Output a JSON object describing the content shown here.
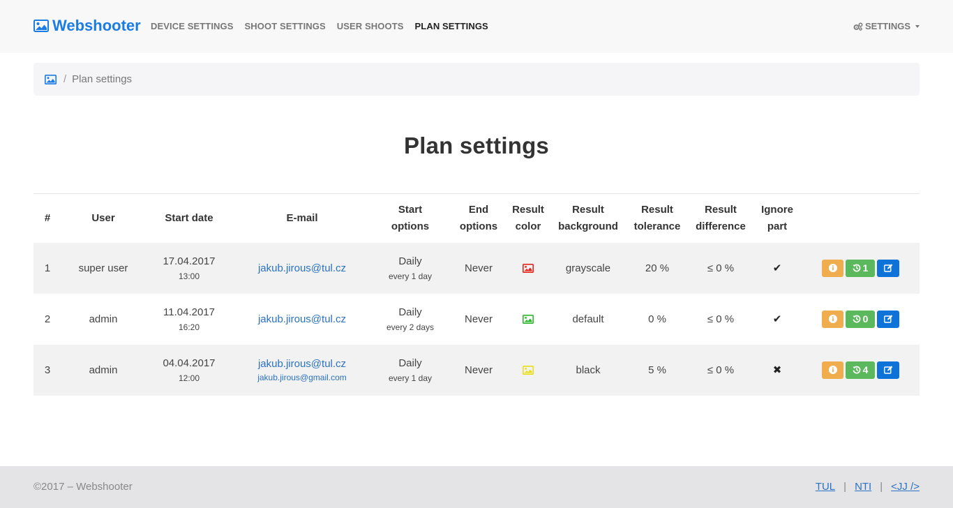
{
  "brand": {
    "name": "Webshooter",
    "icon": "image-icon"
  },
  "nav": {
    "items": [
      {
        "label": "DEVICE SETTINGS",
        "active": false
      },
      {
        "label": "SHOOT SETTINGS",
        "active": false
      },
      {
        "label": "USER SHOOTS",
        "active": false
      },
      {
        "label": "PLAN SETTINGS",
        "active": true
      }
    ],
    "settings_label": "SETTINGS",
    "settings_icon": "gears-icon"
  },
  "breadcrumb": {
    "home_icon": "image-icon",
    "separator": "/",
    "current": "Plan settings"
  },
  "page_title": "Plan settings",
  "table": {
    "headers": [
      "#",
      "User",
      "Start date",
      "E-mail",
      "Start options",
      "End options",
      "Result color",
      "Result background",
      "Result tolerance",
      "Result difference",
      "Ignore part"
    ],
    "rows": [
      {
        "num": "1",
        "user": "super user",
        "date": "17.04.2017",
        "time": "13:00",
        "email": "jakub.jirous@tul.cz",
        "email2": "",
        "start": "Daily",
        "start_sub": "every 1 day",
        "end": "Never",
        "color": "#e5261d",
        "background": "grayscale",
        "tolerance": "20 %",
        "difference": "≤ 0 %",
        "ignore": "✔",
        "history": "1"
      },
      {
        "num": "2",
        "user": "admin",
        "date": "11.04.2017",
        "time": "16:20",
        "email": "jakub.jirous@tul.cz",
        "email2": "",
        "start": "Daily",
        "start_sub": "every 2 days",
        "end": "Never",
        "color": "#2fb82f",
        "background": "default",
        "tolerance": "0 %",
        "difference": "≤ 0 %",
        "ignore": "✔",
        "history": "0"
      },
      {
        "num": "3",
        "user": "admin",
        "date": "04.04.2017",
        "time": "12:00",
        "email": "jakub.jirous@tul.cz",
        "email2": "jakub.jirous@gmail.com",
        "start": "Daily",
        "start_sub": "every 1 day",
        "end": "Never",
        "color": "#e8de1a",
        "background": "black",
        "tolerance": "5 %",
        "difference": "≤ 0 %",
        "ignore": "✖",
        "history": "4"
      }
    ]
  },
  "footer": {
    "copyright": "©2017 – Webshooter",
    "links": [
      "TUL",
      "NTI",
      "<JJ />"
    ],
    "separator": "|"
  },
  "colors": {
    "brand": "#1b7ce3",
    "info": "#f0ad4e",
    "success": "#5cb85c",
    "primary": "#0d73d9",
    "link": "#2a72c5"
  }
}
